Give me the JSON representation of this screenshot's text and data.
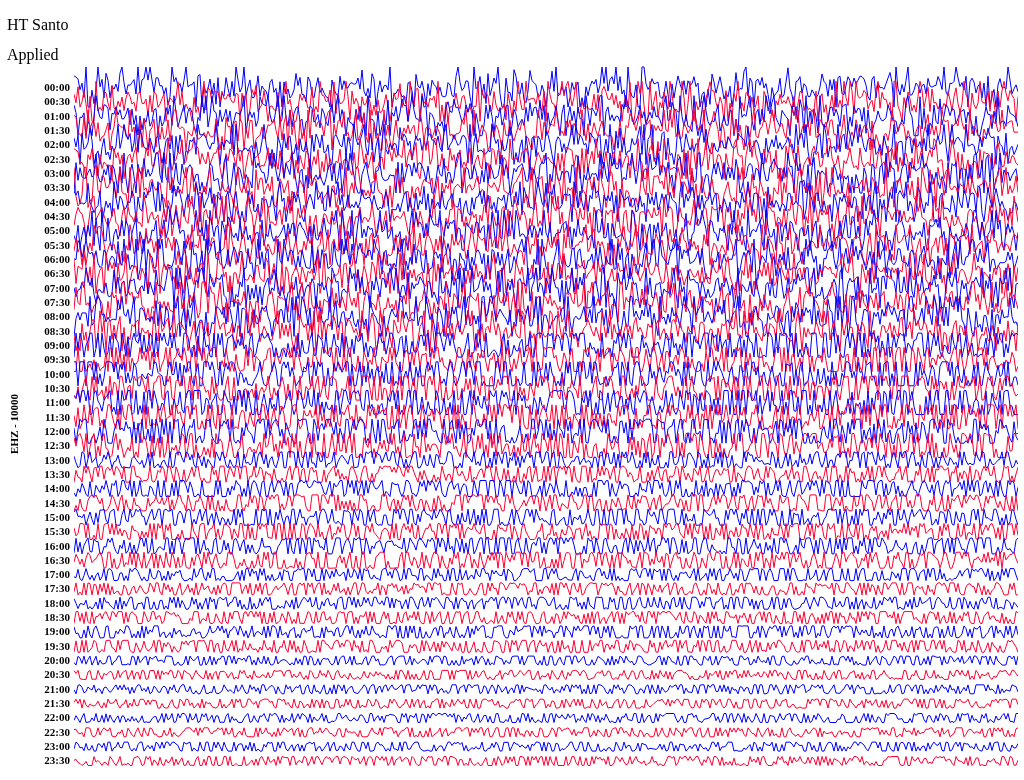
{
  "header": {
    "station": "HT Santo",
    "filter": "Applied"
  },
  "channel_label": "EHZ - 10000",
  "rows": [
    {
      "time": "00:00",
      "color": "#0000ff"
    },
    {
      "time": "00:30",
      "color": "#ff0033"
    },
    {
      "time": "01:00",
      "color": "#0000ff"
    },
    {
      "time": "01:30",
      "color": "#ff0033"
    },
    {
      "time": "02:00",
      "color": "#0000ff"
    },
    {
      "time": "02:30",
      "color": "#ff0033"
    },
    {
      "time": "03:00",
      "color": "#0000ff"
    },
    {
      "time": "03:30",
      "color": "#ff0033"
    },
    {
      "time": "04:00",
      "color": "#0000ff"
    },
    {
      "time": "04:30",
      "color": "#ff0033"
    },
    {
      "time": "05:00",
      "color": "#0000ff"
    },
    {
      "time": "05:30",
      "color": "#ff0033"
    },
    {
      "time": "06:00",
      "color": "#0000ff"
    },
    {
      "time": "06:30",
      "color": "#ff0033"
    },
    {
      "time": "07:00",
      "color": "#0000ff"
    },
    {
      "time": "07:30",
      "color": "#ff0033"
    },
    {
      "time": "08:00",
      "color": "#0000ff"
    },
    {
      "time": "08:30",
      "color": "#ff0033"
    },
    {
      "time": "09:00",
      "color": "#0000ff"
    },
    {
      "time": "09:30",
      "color": "#ff0033"
    },
    {
      "time": "10:00",
      "color": "#0000ff"
    },
    {
      "time": "10:30",
      "color": "#ff0033"
    },
    {
      "time": "11:00",
      "color": "#0000ff"
    },
    {
      "time": "11:30",
      "color": "#ff0033"
    },
    {
      "time": "12:00",
      "color": "#0000ff"
    },
    {
      "time": "12:30",
      "color": "#ff0033"
    },
    {
      "time": "13:00",
      "color": "#0000ff"
    },
    {
      "time": "13:30",
      "color": "#ff0033"
    },
    {
      "time": "14:00",
      "color": "#0000ff"
    },
    {
      "time": "14:30",
      "color": "#ff0033"
    },
    {
      "time": "15:00",
      "color": "#0000ff"
    },
    {
      "time": "15:30",
      "color": "#ff0033"
    },
    {
      "time": "16:00",
      "color": "#0000ff"
    },
    {
      "time": "16:30",
      "color": "#ff0033"
    },
    {
      "time": "17:00",
      "color": "#0000ff"
    },
    {
      "time": "17:30",
      "color": "#ff0033"
    },
    {
      "time": "18:00",
      "color": "#0000ff"
    },
    {
      "time": "18:30",
      "color": "#ff0033"
    },
    {
      "time": "19:00",
      "color": "#0000ff"
    },
    {
      "time": "19:30",
      "color": "#ff0033"
    },
    {
      "time": "20:00",
      "color": "#0000ff"
    },
    {
      "time": "20:30",
      "color": "#ff0033"
    },
    {
      "time": "21:00",
      "color": "#0000ff"
    },
    {
      "time": "21:30",
      "color": "#ff0033"
    },
    {
      "time": "22:00",
      "color": "#0000ff"
    },
    {
      "time": "22:30",
      "color": "#ff0033"
    },
    {
      "time": "23:00",
      "color": "#0000ff"
    },
    {
      "time": "23:30",
      "color": "#ff0033"
    }
  ]
}
